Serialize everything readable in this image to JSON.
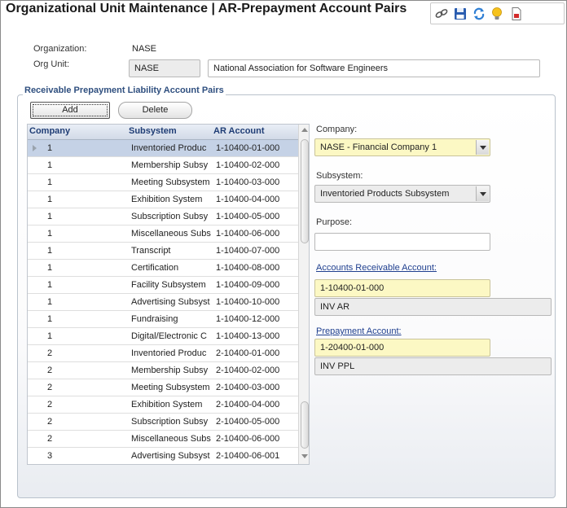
{
  "window": {
    "title": "Organizational Unit Maintenance | AR-Prepayment Account Pairs"
  },
  "toolbar": {
    "icons": [
      "link-icon",
      "save-icon",
      "refresh-icon",
      "lightbulb-icon",
      "report-icon"
    ]
  },
  "header": {
    "organization_label": "Organization:",
    "organization_value": "NASE",
    "org_unit_label": "Org Unit:",
    "org_unit_code": "NASE",
    "org_unit_name": "National Association for Software Engineers"
  },
  "group": {
    "title": "Receivable Prepayment Liability Account Pairs",
    "add_label": "Add",
    "delete_label": "Delete"
  },
  "grid": {
    "columns": [
      "Company",
      "Subsystem",
      "AR Account"
    ],
    "rows": [
      {
        "company": "1",
        "subsystem": "Inventoried Produc",
        "account": "1-10400-01-000"
      },
      {
        "company": "1",
        "subsystem": "Membership Subsy",
        "account": "1-10400-02-000"
      },
      {
        "company": "1",
        "subsystem": "Meeting Subsystem",
        "account": "1-10400-03-000"
      },
      {
        "company": "1",
        "subsystem": "Exhibition System",
        "account": "1-10400-04-000"
      },
      {
        "company": "1",
        "subsystem": "Subscription Subsy",
        "account": "1-10400-05-000"
      },
      {
        "company": "1",
        "subsystem": "Miscellaneous Subs",
        "account": "1-10400-06-000"
      },
      {
        "company": "1",
        "subsystem": "Transcript",
        "account": "1-10400-07-000"
      },
      {
        "company": "1",
        "subsystem": "Certification",
        "account": "1-10400-08-000"
      },
      {
        "company": "1",
        "subsystem": "Facility Subsystem",
        "account": "1-10400-09-000"
      },
      {
        "company": "1",
        "subsystem": "Advertising Subsyst",
        "account": "1-10400-10-000"
      },
      {
        "company": "1",
        "subsystem": "Fundraising",
        "account": "1-10400-12-000"
      },
      {
        "company": "1",
        "subsystem": "Digital/Electronic C",
        "account": "1-10400-13-000"
      },
      {
        "company": "2",
        "subsystem": "Inventoried Produc",
        "account": "2-10400-01-000"
      },
      {
        "company": "2",
        "subsystem": "Membership Subsy",
        "account": "2-10400-02-000"
      },
      {
        "company": "2",
        "subsystem": "Meeting Subsystem",
        "account": "2-10400-03-000"
      },
      {
        "company": "2",
        "subsystem": "Exhibition System",
        "account": "2-10400-04-000"
      },
      {
        "company": "2",
        "subsystem": "Subscription Subsy",
        "account": "2-10400-05-000"
      },
      {
        "company": "2",
        "subsystem": "Miscellaneous Subs",
        "account": "2-10400-06-000"
      },
      {
        "company": "3",
        "subsystem": "Advertising Subsyst",
        "account": "2-10400-06-001"
      }
    ],
    "selected_index": 0
  },
  "detail": {
    "company_label": "Company:",
    "company_value": "NASE - Financial Company 1",
    "subsystem_label": "Subsystem:",
    "subsystem_value": "Inventoried Products Subsystem",
    "purpose_label": "Purpose:",
    "purpose_value": "",
    "ar_account_label": "Accounts Receivable Account:",
    "ar_account_value": "1-10400-01-000",
    "ar_account_desc": "INV AR",
    "prepay_account_label": "Prepayment Account:",
    "prepay_account_value": "1-20400-01-000",
    "prepay_account_desc": "INV PPL"
  }
}
